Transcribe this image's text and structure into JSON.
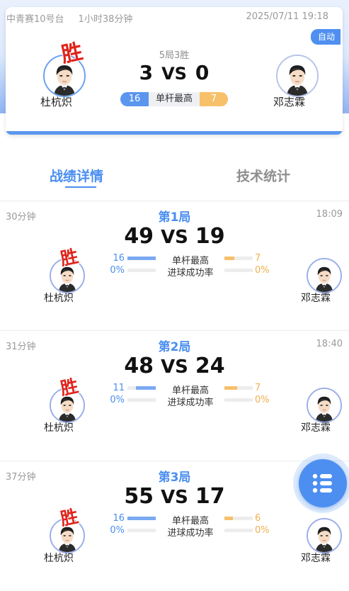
{
  "match": {
    "table": "中青赛10号台",
    "duration": "1小时38分钟",
    "datetime": "2025/07/11 19:18",
    "mode_badge": "自动",
    "format": "5局3胜",
    "score_left": "3",
    "vs": "VS",
    "score_right": "0",
    "win_mark": "胜",
    "player_left": "杜杭炽",
    "player_right": "邓志霖",
    "best_break_label": "单杆最高",
    "best_break_left": "16",
    "best_break_right": "7"
  },
  "tabs": [
    {
      "label": "战绩详情",
      "active": true
    },
    {
      "label": "技术统计",
      "active": false
    }
  ],
  "labels": {
    "best_break": "单杆最高",
    "pot_rate": "进球成功率"
  },
  "frames": [
    {
      "duration": "30分钟",
      "title": "第1局",
      "time": "18:09",
      "score_left": "49",
      "score_right": "19",
      "break_left": "16",
      "break_right": "7",
      "break_left_frac": 1.0,
      "break_right_frac": 0.35,
      "rate_left": "0%",
      "rate_right": "0%",
      "rate_left_frac": 0,
      "rate_right_frac": 0,
      "winner": "left",
      "player_left": "杜杭炽",
      "player_right": "邓志霖"
    },
    {
      "duration": "31分钟",
      "title": "第2局",
      "time": "18:40",
      "score_left": "48",
      "score_right": "24",
      "break_left": "11",
      "break_right": "7",
      "break_left_frac": 0.7,
      "break_right_frac": 0.45,
      "rate_left": "0%",
      "rate_right": "0%",
      "rate_left_frac": 0,
      "rate_right_frac": 0,
      "winner": "left",
      "player_left": "杜杭炽",
      "player_right": "邓志霖"
    },
    {
      "duration": "37分钟",
      "title": "第3局",
      "time": "",
      "score_left": "55",
      "score_right": "17",
      "break_left": "16",
      "break_right": "6",
      "break_left_frac": 1.0,
      "break_right_frac": 0.3,
      "rate_left": "0%",
      "rate_right": "0%",
      "rate_left_frac": 0,
      "rate_right_frac": 0,
      "winner": "left",
      "player_left": "杜杭炽",
      "player_right": "邓志霖"
    }
  ],
  "fab_icon": "list-menu-icon",
  "colors": {
    "accent": "#4a8ef0",
    "opponent": "#f5c06a",
    "win": "#e0231b"
  }
}
